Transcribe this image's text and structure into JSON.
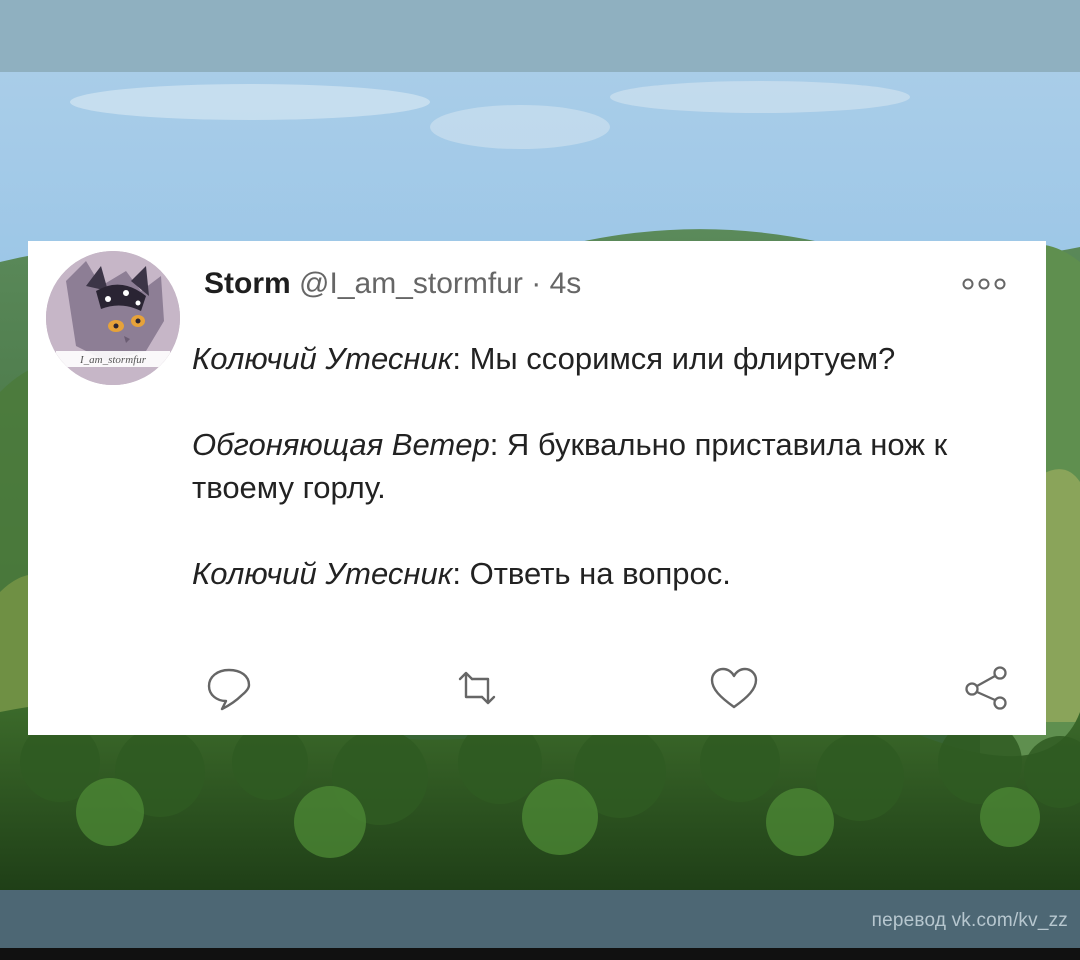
{
  "tweet": {
    "display_name": "Storm",
    "handle": "@I_am_stormfur",
    "separator": "·",
    "time": "4s",
    "avatar_caption": "I_am_stormfur",
    "more_icon": "more-dots-icon",
    "lines": [
      {
        "speaker": "Колючий Утесник",
        "colon": ":",
        "text": " Мы ссоримся или флиртуем?"
      },
      {
        "speaker": "Обгоняющая Ветер",
        "colon": ":",
        "text": " Я буквально приставила нож к твоему горлу."
      },
      {
        "speaker": "Колючий Утесник",
        "colon": ":",
        "text": " Ответь на вопрос."
      }
    ],
    "actions": {
      "reply": "reply-icon",
      "retweet": "retweet-icon",
      "like": "heart-icon",
      "share": "share-icon"
    }
  },
  "footer": {
    "credit": "перевод vk.com/kv_zz"
  },
  "colors": {
    "card_bg": "#ffffff",
    "text": "#222222",
    "muted": "#666666",
    "bottom_band": "#4d6774",
    "top_band": "#8fb0c0"
  }
}
